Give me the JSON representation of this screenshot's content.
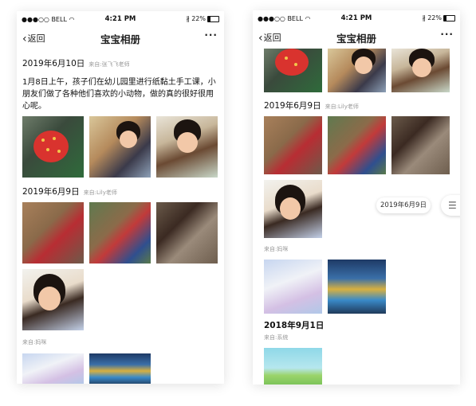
{
  "status_bar": {
    "carrier": "●●●○○ BELL",
    "time": "4:21 PM",
    "battery": "22%"
  },
  "nav": {
    "back_label": "返回",
    "title": "宝宝相册",
    "more_label": "···"
  },
  "left": {
    "section1": {
      "date": "2019年6月10日",
      "source": "来自:张飞飞老师",
      "text": "1月8日上午，孩子们在幼儿园里进行纸黏土手工课，小朋友们做了各种他们喜欢的小动物，做的真的很好很用心呢。"
    },
    "section2": {
      "date": "2019年6月9日",
      "source": "来自:Lily老师",
      "source2": "来自:妈咪"
    }
  },
  "right": {
    "section1": {
      "date": "2019年6月9日",
      "source": "来自:Lily老师",
      "source2": "来自:妈咪"
    },
    "section2": {
      "date": "2018年9月1日",
      "source": "来自:系统"
    },
    "floating_date": "2019年6月9日",
    "menu_icon": "list-icon"
  }
}
